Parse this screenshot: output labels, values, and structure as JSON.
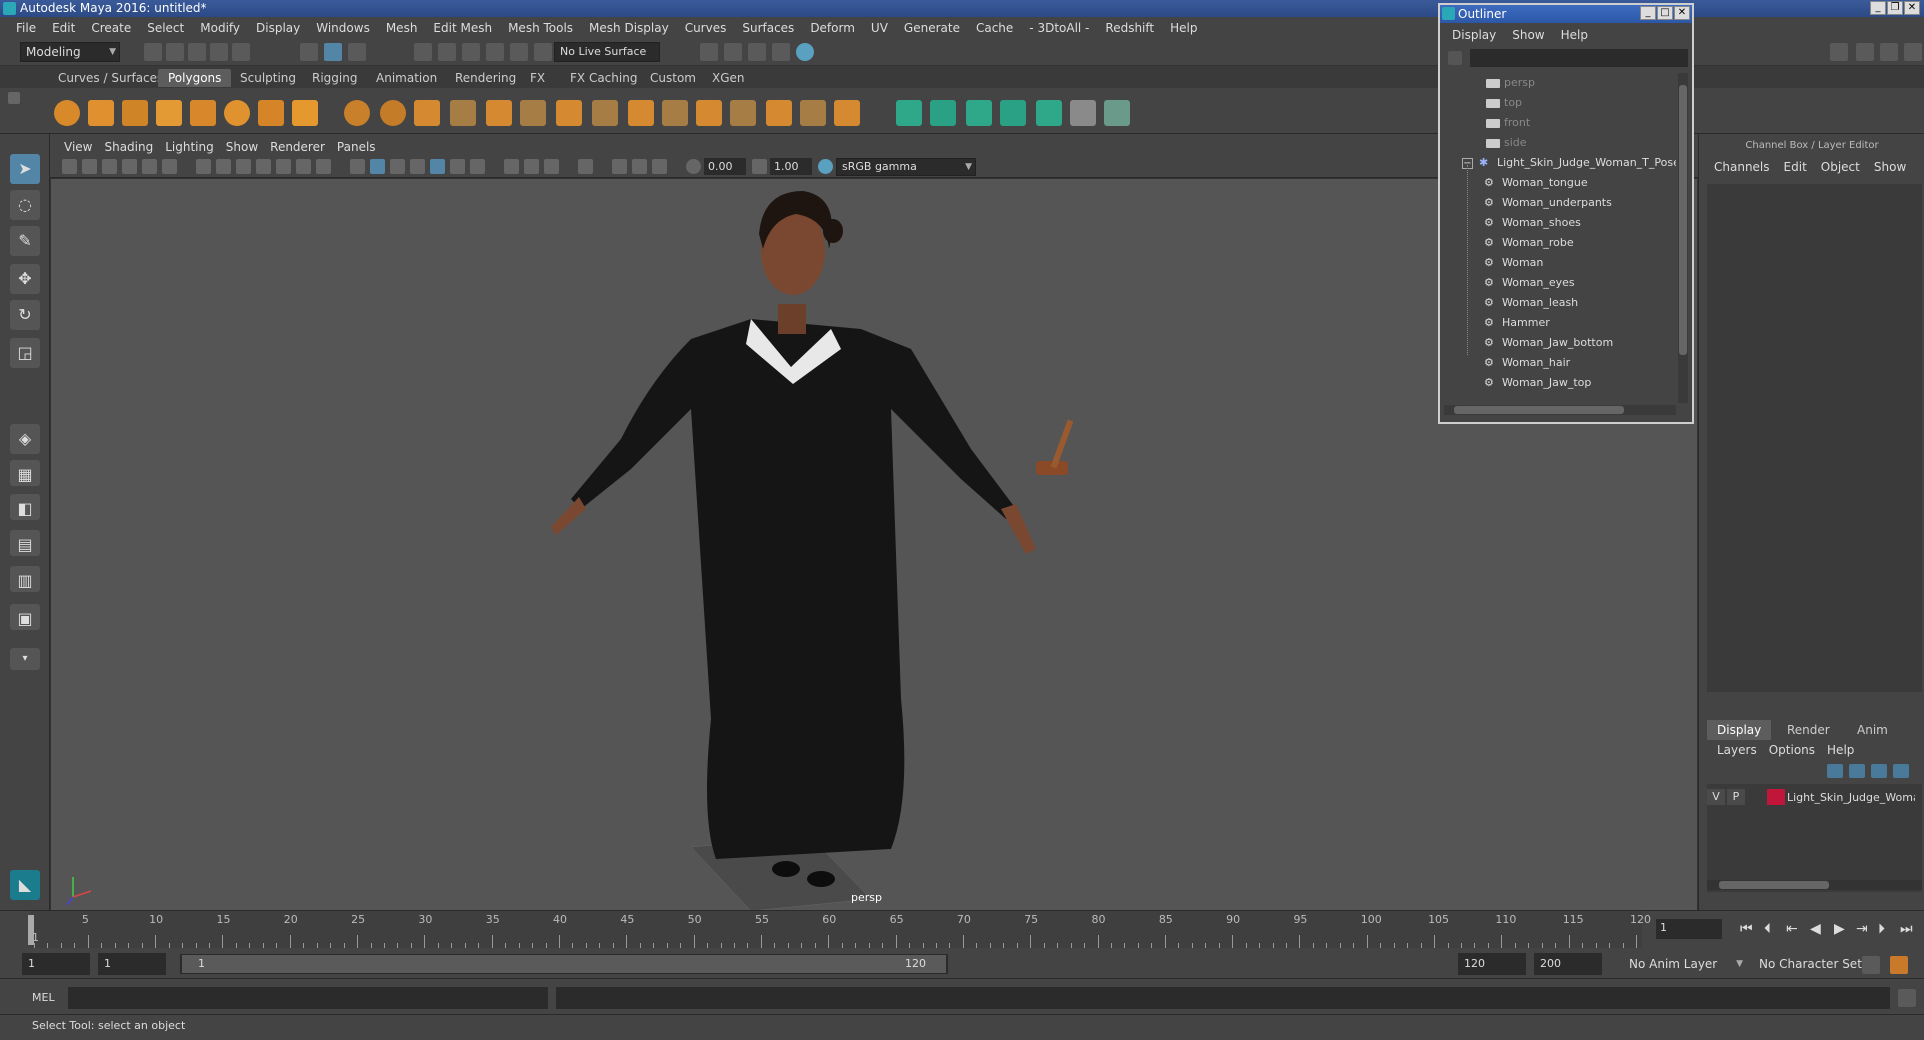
{
  "window": {
    "title": "Autodesk Maya 2016: untitled*"
  },
  "menu": [
    "File",
    "Edit",
    "Create",
    "Select",
    "Modify",
    "Display",
    "Windows",
    "Mesh",
    "Edit Mesh",
    "Mesh Tools",
    "Mesh Display",
    "Curves",
    "Surfaces",
    "Deform",
    "UV",
    "Generate",
    "Cache",
    "- 3DtoAll -",
    "Redshift",
    "Help"
  ],
  "status_line": {
    "mode": "Modeling",
    "live_surface": "No Live Surface"
  },
  "shelf_tabs": [
    "Curves / Surfaces",
    "Polygons",
    "Sculpting",
    "Rigging",
    "Animation",
    "Rendering",
    "FX",
    "FX Caching",
    "Custom",
    "XGen"
  ],
  "active_shelf_tab": "Polygons",
  "viewport": {
    "menu": [
      "View",
      "Shading",
      "Lighting",
      "Show",
      "Renderer",
      "Panels"
    ],
    "exposure": "0.00",
    "gamma": "1.00",
    "color_space": "sRGB gamma",
    "camera_label": "persp"
  },
  "outliner": {
    "title": "Outliner",
    "menu": [
      "Display",
      "Show",
      "Help"
    ],
    "cameras": [
      "persp",
      "top",
      "front",
      "side"
    ],
    "group": "Light_Skin_Judge_Woman_T_Pose",
    "children": [
      "Woman_tongue",
      "Woman_underpants",
      "Woman_shoes",
      "Woman_robe",
      "Woman",
      "Woman_eyes",
      "Woman_leash",
      "Hammer",
      "Woman_Jaw_bottom",
      "Woman_hair",
      "Woman_Jaw_top"
    ]
  },
  "channel_box": {
    "title": "Channel Box / Layer Editor",
    "menu": [
      "Channels",
      "Edit",
      "Object",
      "Show"
    ],
    "layer_tabs": [
      "Display",
      "Render",
      "Anim"
    ],
    "layer_menu": [
      "Layers",
      "Options",
      "Help"
    ],
    "layer": {
      "v": "V",
      "p": "P",
      "name": "Light_Skin_Judge_Woman_T_Pose",
      "color": "#c0163a"
    }
  },
  "timeline": {
    "labels": [
      "5",
      "10",
      "15",
      "20",
      "25",
      "30",
      "35",
      "40",
      "45",
      "50",
      "55",
      "60",
      "65",
      "70",
      "75",
      "80",
      "85",
      "90",
      "95",
      "100",
      "105",
      "110",
      "115",
      "120"
    ],
    "current_frame_label": "1",
    "current_frame": "1"
  },
  "range": {
    "start": "1",
    "playback_start": "1",
    "slider_start": "1",
    "slider_end": "120",
    "playback_end": "120",
    "end": "200",
    "anim_layer": "No Anim Layer",
    "char_set": "No Character Set"
  },
  "cmd": {
    "lang": "MEL"
  },
  "help_line": "Select Tool: select an object"
}
